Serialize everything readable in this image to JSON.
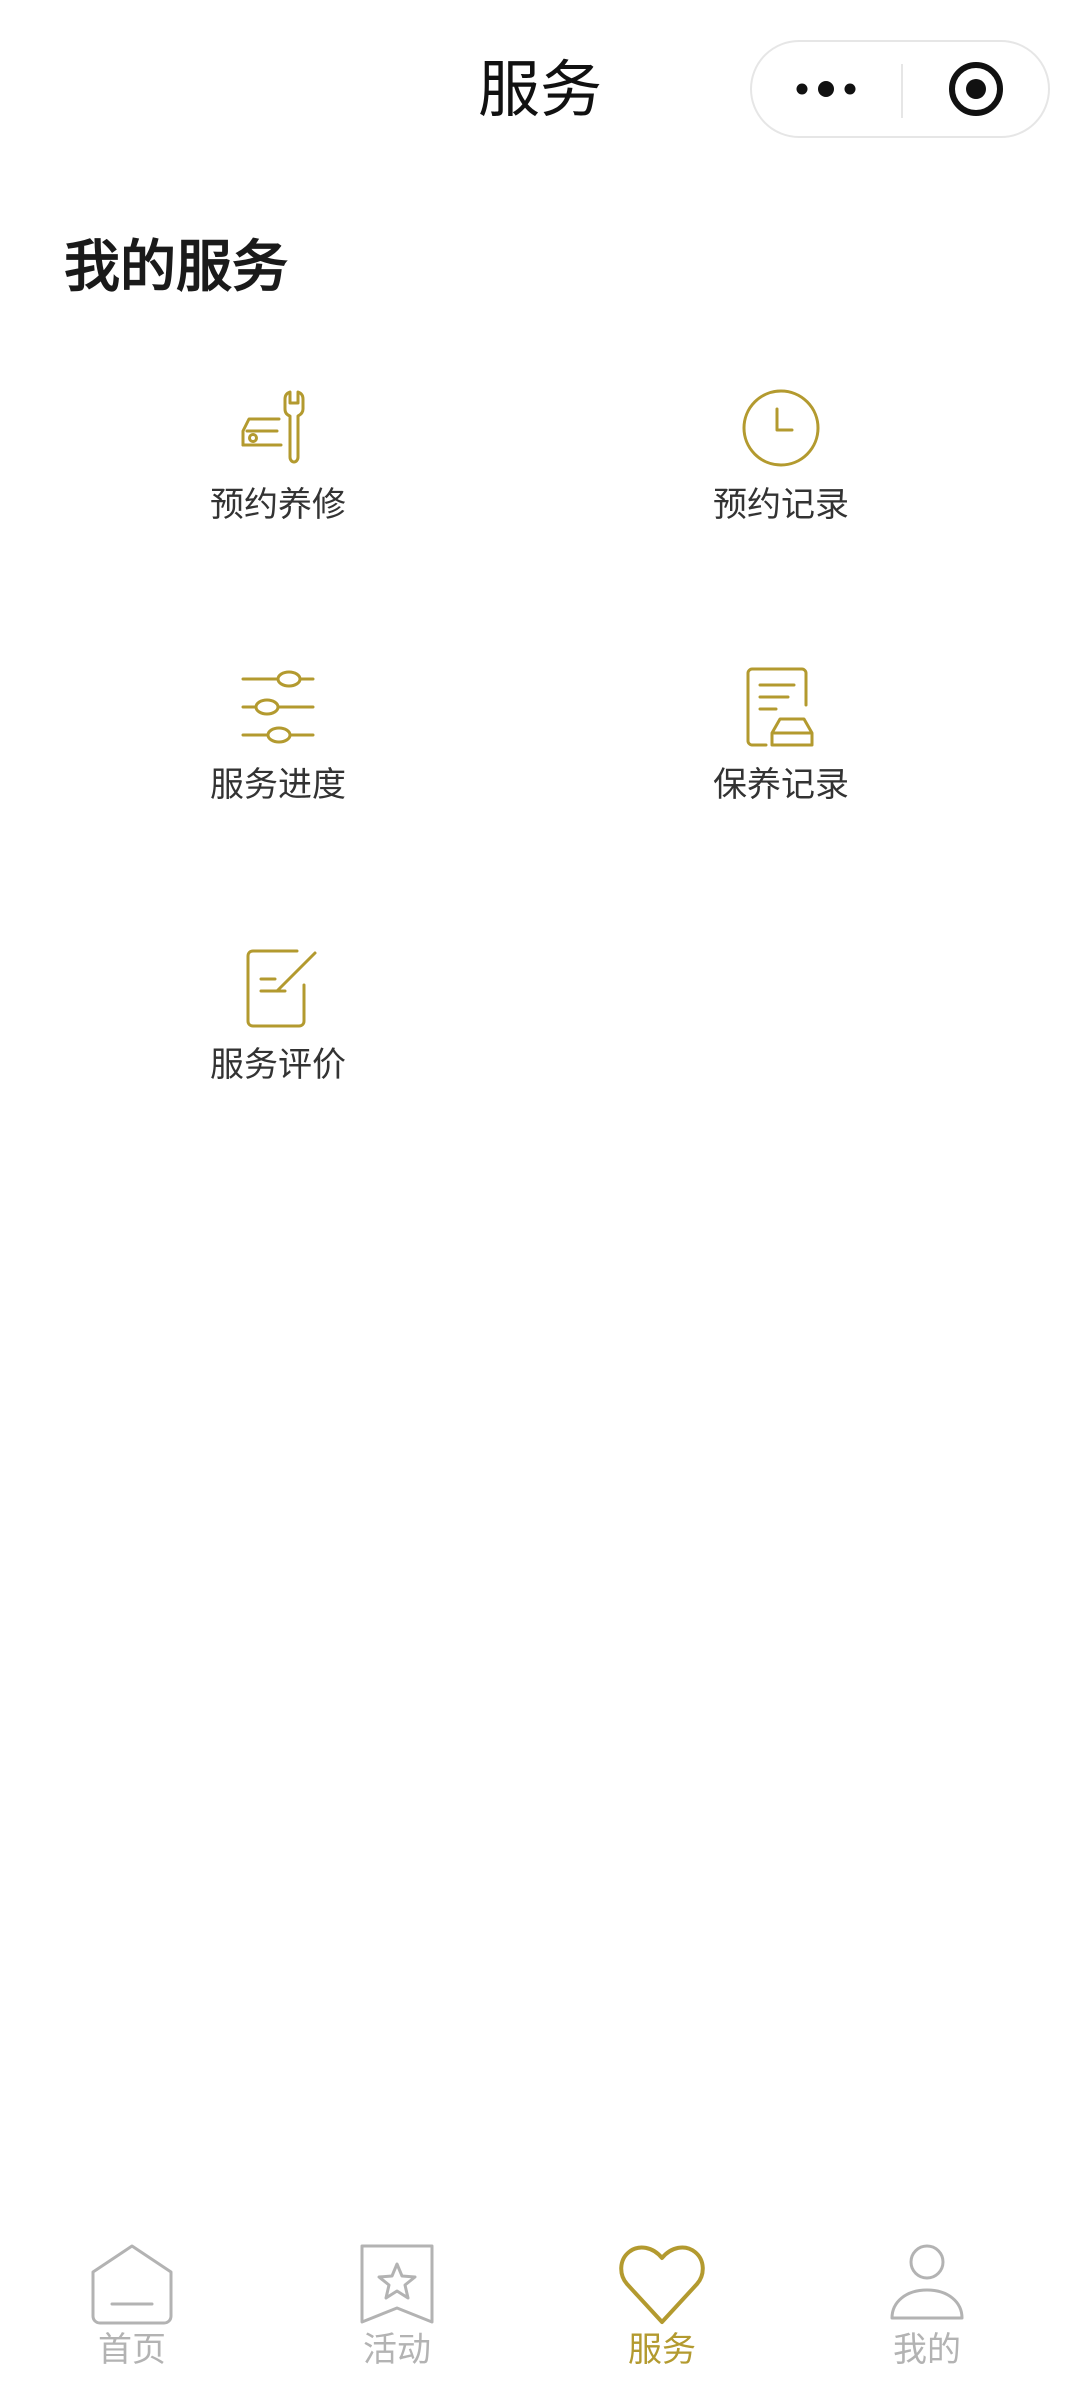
{
  "header": {
    "title": "服务"
  },
  "section": {
    "title": "我的服务"
  },
  "services": [
    {
      "label": "预约养修",
      "icon": "car-wrench-icon"
    },
    {
      "label": "预约记录",
      "icon": "clock-icon"
    },
    {
      "label": "服务进度",
      "icon": "sliders-icon"
    },
    {
      "label": "保养记录",
      "icon": "car-document-icon"
    },
    {
      "label": "服务评价",
      "icon": "edit-document-icon"
    }
  ],
  "tabbar": {
    "items": [
      {
        "label": "首页",
        "icon": "home-icon",
        "active": false
      },
      {
        "label": "活动",
        "icon": "star-bookmark-icon",
        "active": false
      },
      {
        "label": "服务",
        "icon": "heart-icon",
        "active": true
      },
      {
        "label": "我的",
        "icon": "person-icon",
        "active": false
      }
    ]
  },
  "colors": {
    "accent": "#b39a2f",
    "inactive": "#b3b3b3",
    "text": "#333333"
  }
}
